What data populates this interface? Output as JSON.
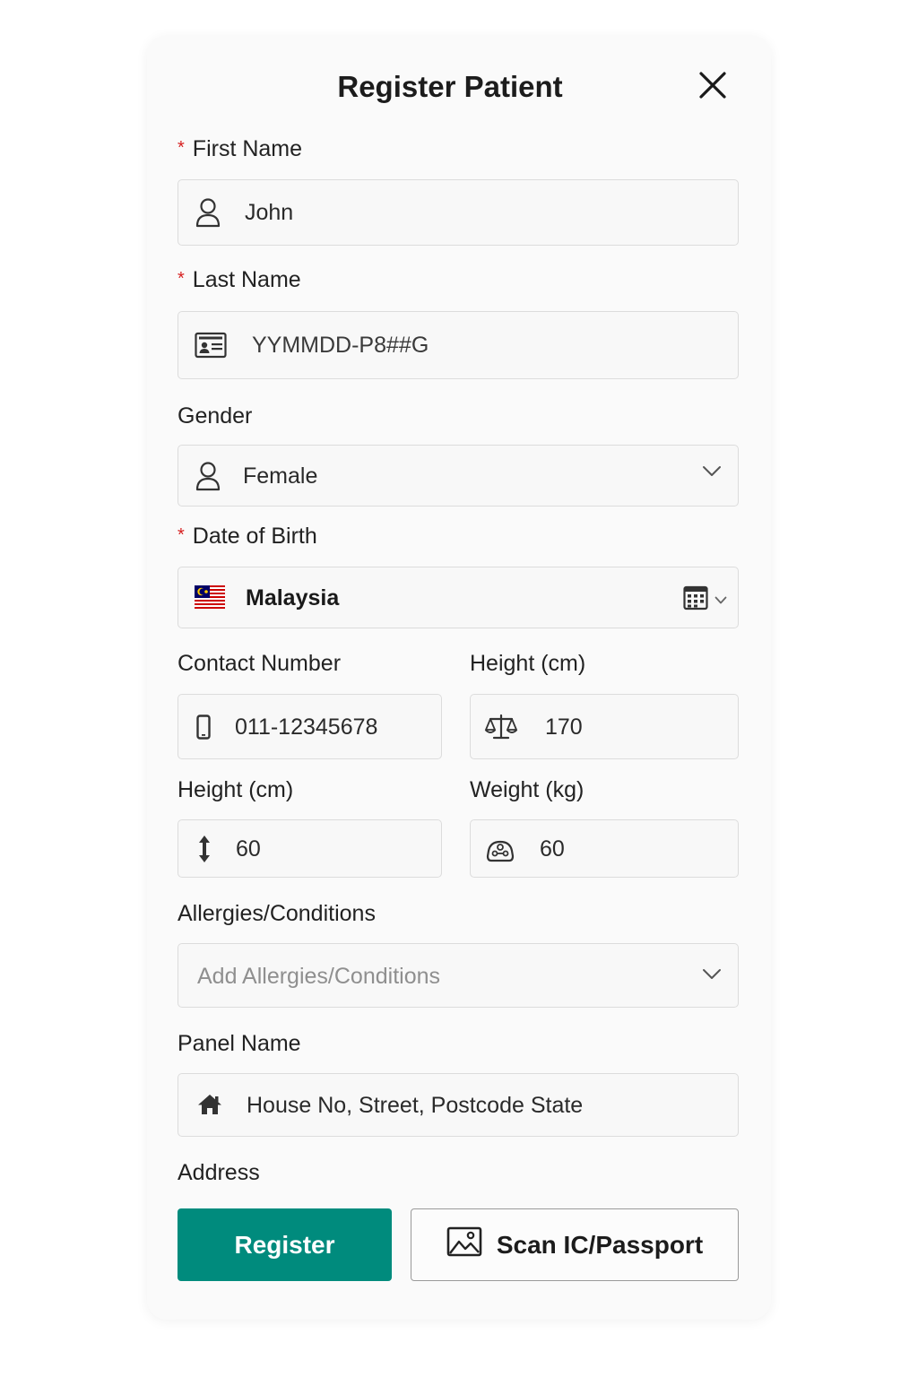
{
  "dialog": {
    "title": "Register Patient",
    "close_icon": "close-icon"
  },
  "fields": {
    "first_name": {
      "label": "First Name",
      "required": true,
      "value": "John",
      "icon": "user-icon"
    },
    "last_name": {
      "label": "Last Name",
      "required": true,
      "value": "YYMMDD-P8##G",
      "icon": "id-card-icon"
    },
    "gender": {
      "label": "Gender",
      "required": false,
      "value": "Female",
      "icon": "user-icon"
    },
    "date_of_birth": {
      "label": "Date of Birth",
      "required": true,
      "value": "Malaysia",
      "icon": "malaysia-flag-icon"
    },
    "contact_number": {
      "label": "Contact Number",
      "value": "011-12345678",
      "icon": "phone-icon"
    },
    "height_right": {
      "label": "Height (cm)",
      "value": "170",
      "icon": "scale-icon"
    },
    "height_left": {
      "label": "Height (cm)",
      "value": "60",
      "icon": "height-arrow-icon"
    },
    "weight": {
      "label": "Weight (kg)",
      "value": "60",
      "icon": "weight-icon"
    },
    "allergies": {
      "label": "Allergies/Conditions",
      "placeholder": "Add Allergies/Conditions"
    },
    "panel_name": {
      "label": "Panel Name",
      "value": "House No, Street, Postcode State",
      "icon": "home-icon"
    },
    "address": {
      "label": "Address"
    }
  },
  "actions": {
    "register_label": "Register",
    "scan_label": "Scan IC/Passport",
    "scan_icon": "image-icon"
  },
  "colors": {
    "primary": "#008b7d",
    "required": "#d62020",
    "border": "#dcdcdc"
  }
}
